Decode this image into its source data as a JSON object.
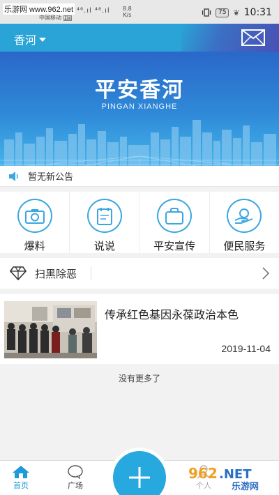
{
  "status_bar": {
    "watermark": "乐游网 www.962.net",
    "carrier": "中国移动",
    "hd": "HD",
    "signal": "⁴⁶.ıl ⁴⁶.ıl",
    "speed_value": "8.8",
    "speed_unit": "K/s",
    "battery": "75",
    "time": "10:31"
  },
  "header": {
    "city": "香河",
    "mail_icon": "mail-icon"
  },
  "banner": {
    "title": "平安香河",
    "subtitle": "PINGAN XIANGHE"
  },
  "notice": {
    "icon": "speaker-icon",
    "text": "暂无新公告"
  },
  "quick_actions": [
    {
      "label": "爆料",
      "icon": "camera-icon"
    },
    {
      "label": "说说",
      "icon": "note-icon"
    },
    {
      "label": "平安宣传",
      "icon": "bag-icon"
    },
    {
      "label": "便民服务",
      "icon": "hand-icon"
    }
  ],
  "section": {
    "title": "扫黑除恶",
    "icon": "diamond-icon"
  },
  "article": {
    "title": "传承红色基因永葆政治本色",
    "date": "2019-11-04"
  },
  "list_footer": "没有更多了",
  "bottom_nav": {
    "tabs": [
      {
        "label": "首页",
        "icon": "home-icon",
        "active": true
      },
      {
        "label": "广场",
        "icon": "chat-icon",
        "active": false
      },
      {
        "label": "个人",
        "icon": "user-icon",
        "active": false
      }
    ],
    "fab_icon": "plus-icon"
  },
  "watermark_logo": "962.NET 乐游网",
  "colors": {
    "accent": "#2aa4d6",
    "active_tab": "#1e9ad6"
  }
}
